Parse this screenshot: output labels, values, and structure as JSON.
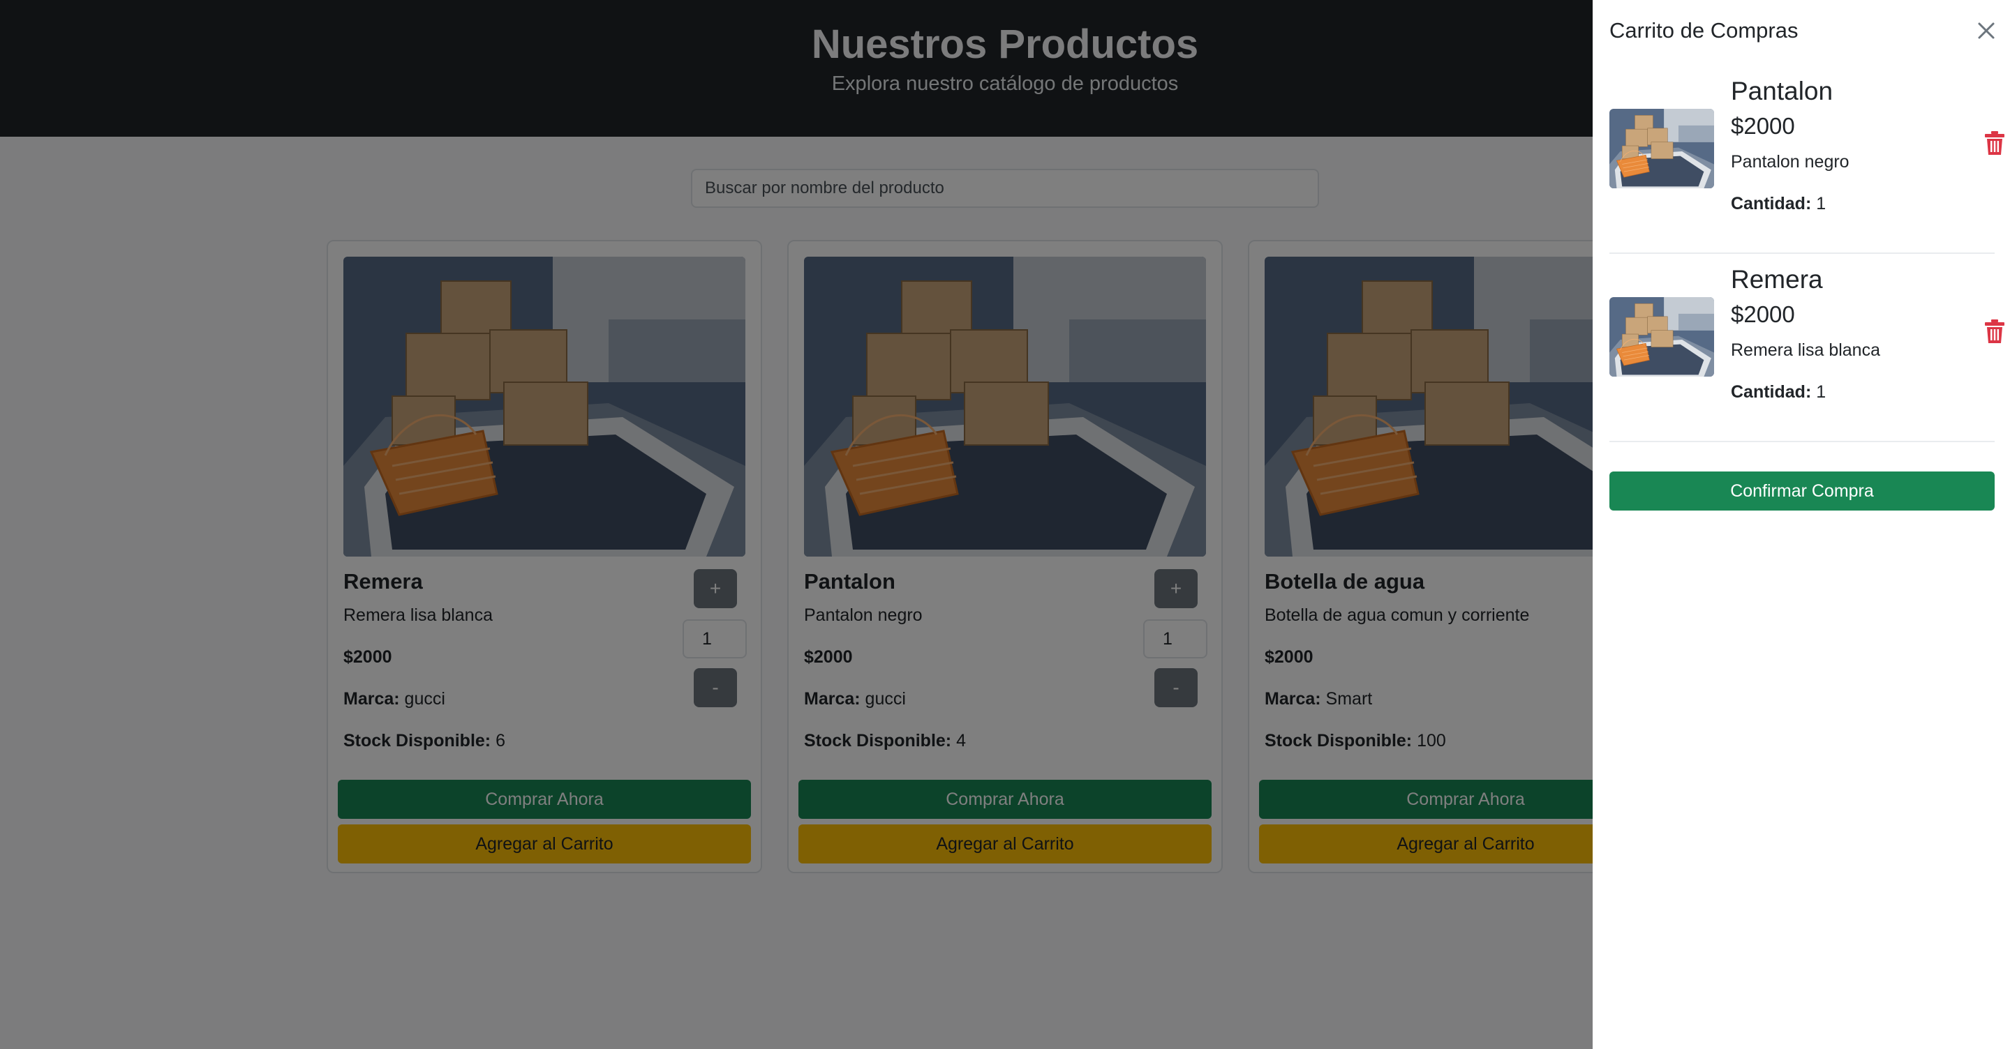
{
  "header": {
    "title": "Nuestros Productos",
    "subtitle": "Explora nuestro catálogo de productos"
  },
  "search": {
    "placeholder": "Buscar por nombre del producto"
  },
  "products": [
    {
      "name": "Remera",
      "description": "Remera lisa blanca",
      "price": "$2000",
      "brand_label": "Marca:",
      "brand": "gucci",
      "stock_label": "Stock Disponible:",
      "stock": "6",
      "quantity": "1",
      "plus": "+",
      "minus": "-",
      "buy_label": "Comprar Ahora",
      "add_label": "Agregar al Carrito"
    },
    {
      "name": "Pantalon",
      "description": "Pantalon negro",
      "price": "$2000",
      "brand_label": "Marca:",
      "brand": "gucci",
      "stock_label": "Stock Disponible:",
      "stock": "4",
      "quantity": "1",
      "plus": "+",
      "minus": "-",
      "buy_label": "Comprar Ahora",
      "add_label": "Agregar al Carrito"
    },
    {
      "name": "Botella de agua",
      "description": "Botella de agua comun y corriente",
      "price": "$2000",
      "brand_label": "Marca:",
      "brand": "Smart",
      "stock_label": "Stock Disponible:",
      "stock": "100",
      "buy_label": "Comprar Ahora",
      "add_label": "Agregar al Carrito"
    }
  ],
  "cart": {
    "title": "Carrito de Compras",
    "close_icon": "close-icon",
    "items": [
      {
        "name": "Pantalon",
        "price": "$2000",
        "description": "Pantalon negro",
        "qty_label": "Cantidad:",
        "qty": "1",
        "delete_icon": "trash-icon"
      },
      {
        "name": "Remera",
        "price": "$2000",
        "description": "Remera lisa blanca",
        "qty_label": "Cantidad:",
        "qty": "1",
        "delete_icon": "trash-icon"
      }
    ],
    "confirm_label": "Confirmar Compra"
  },
  "colors": {
    "header_bg": "#212529",
    "success": "#198754",
    "warning": "#ffc107",
    "secondary": "#6c757d",
    "danger": "#dc3545"
  }
}
